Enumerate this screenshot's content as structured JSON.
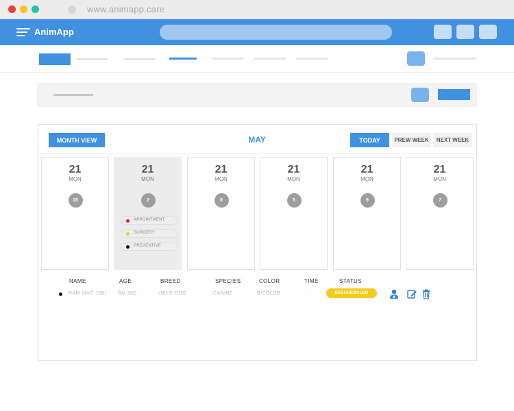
{
  "browser": {
    "url": "www.animapp.care"
  },
  "app": {
    "brand": "AnimApp"
  },
  "calendar": {
    "month_view_label": "MONTH VIEW",
    "month_title": "MAY",
    "today_label": "TODAY",
    "prev_week_label": "PREW WEEK",
    "next_week_label": "NEXT WEEK",
    "days": [
      {
        "date": "21",
        "weekday": "MON",
        "count": "15"
      },
      {
        "date": "21",
        "weekday": "MON",
        "count": "2"
      },
      {
        "date": "21",
        "weekday": "MON",
        "count": "0"
      },
      {
        "date": "21",
        "weekday": "MON",
        "count": "5"
      },
      {
        "date": "21",
        "weekday": "MON",
        "count": "9"
      },
      {
        "date": "21",
        "weekday": "MON",
        "count": "7"
      }
    ],
    "legend": [
      {
        "label": "APPOINTMENT",
        "color": "#e32323"
      },
      {
        "label": "SURGERY",
        "color": "#e8d21c"
      },
      {
        "label": "PREVENTIVE",
        "color": "#111111"
      }
    ]
  },
  "table": {
    "headers": {
      "name": "NAME",
      "age": "AGE",
      "breed": "BREED",
      "species": "SPECIES",
      "color": "COLOR",
      "time": "TIME",
      "status": "STATUS"
    },
    "row": {
      "name": "RAM (AVC-106)",
      "age": "SM 28D",
      "breed": "INDIE DOG",
      "species": "CANINE",
      "color": "BICOLOR",
      "time": "-",
      "status": "RESCHEDULED"
    }
  },
  "icons": {
    "vet": "doctor-icon",
    "edit": "edit-icon",
    "delete": "trash-icon"
  },
  "colors": {
    "accent": "#4191e1",
    "status_rescheduled": "#f2cb1e"
  }
}
